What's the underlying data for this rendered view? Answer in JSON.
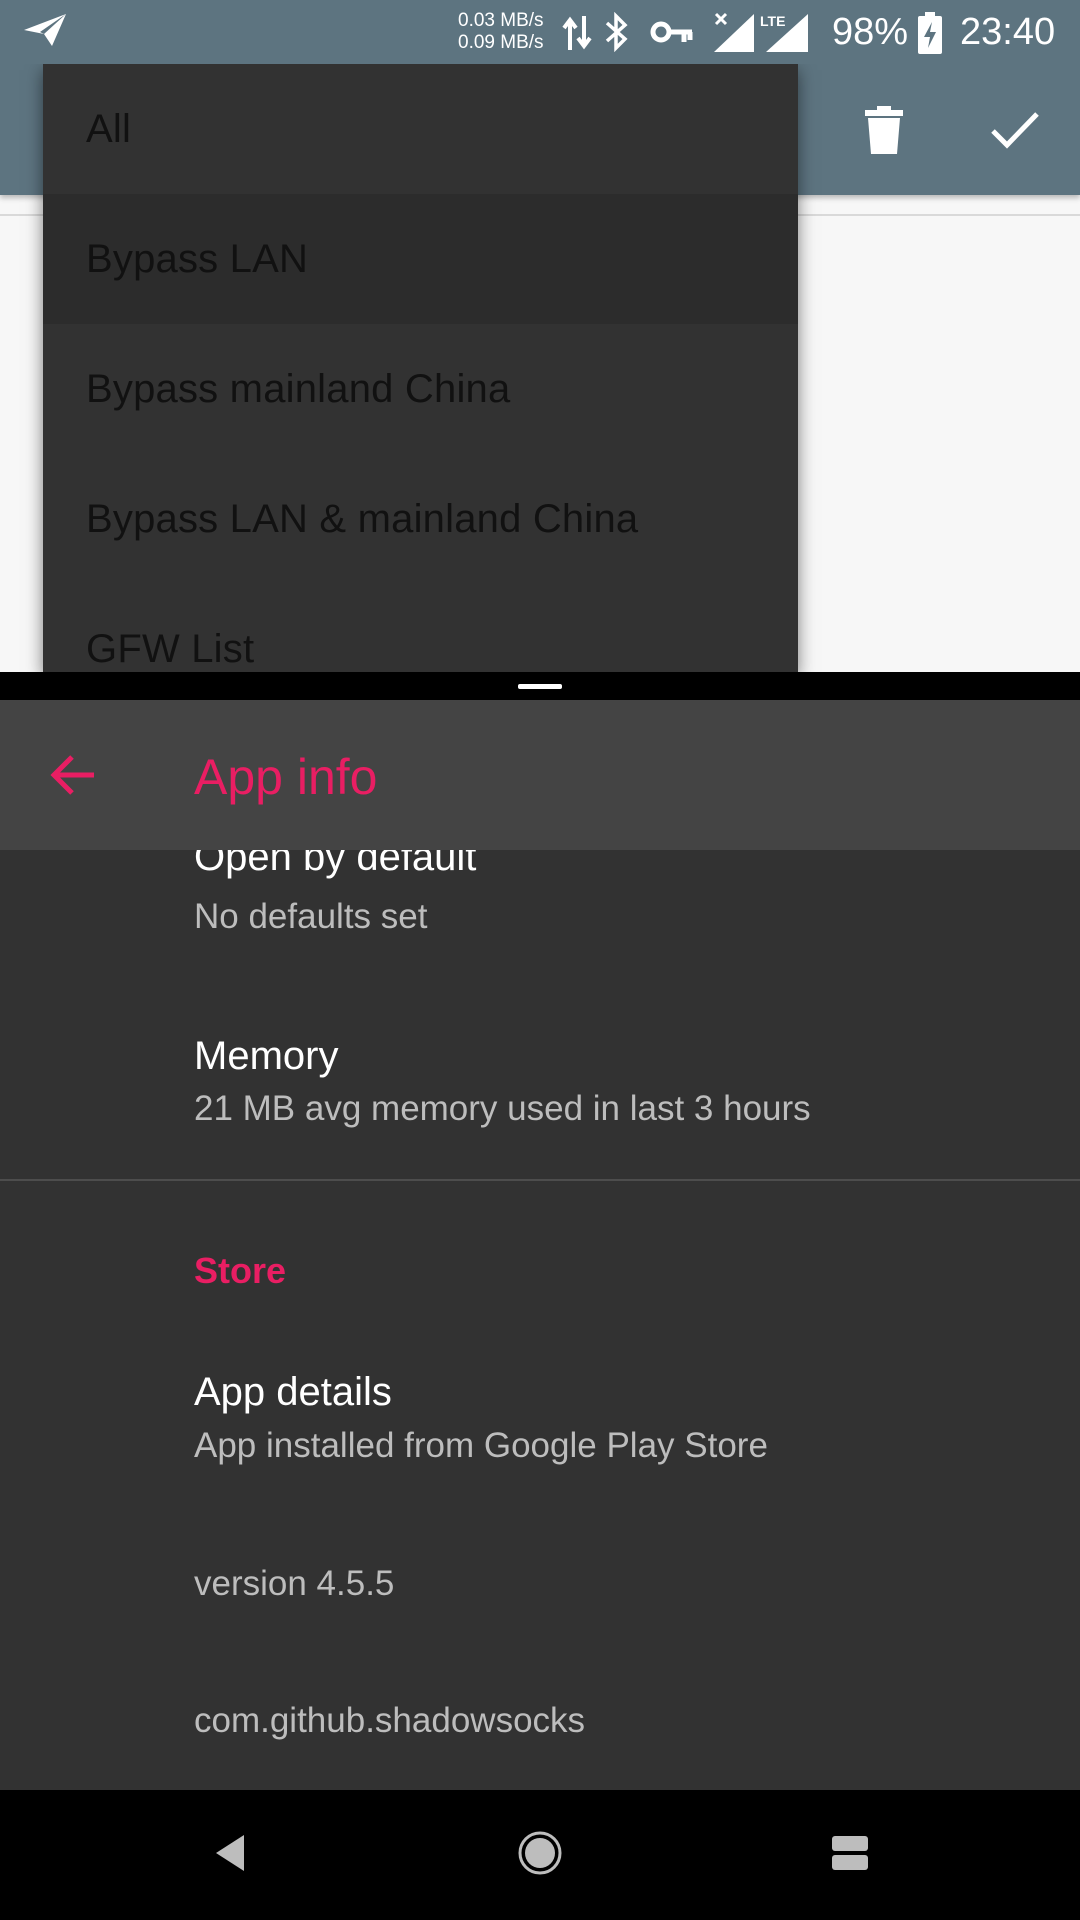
{
  "status_bar": {
    "upload_speed": "0.03 MB/s",
    "download_speed": "0.09 MB/s",
    "network_type": "LTE",
    "battery": "98%",
    "time": "23:40",
    "icons": [
      "shadowsocks-icon",
      "data-transfer-icon",
      "bluetooth-icon",
      "vpn-key-icon",
      "wifi-signal-icon",
      "cellular-signal-icon",
      "battery-charging-icon"
    ]
  },
  "top_app": {
    "toolbar": {
      "delete_icon": "trash-icon",
      "confirm_icon": "check-icon",
      "color": "#5d7480"
    },
    "dropdown": {
      "items": [
        "All",
        "Bypass LAN",
        "Bypass mainland China",
        "Bypass LAN & mainland China",
        "GFW List"
      ],
      "highlighted_index": 1
    }
  },
  "bottom_app": {
    "title": "App info",
    "accent": "#e91e63",
    "prefs": [
      {
        "title": "Open by default",
        "summary": "No defaults set"
      },
      {
        "title": "Memory",
        "summary": "21 MB avg memory used in last 3 hours"
      }
    ],
    "store": {
      "header": "Store",
      "app_details_title": "App details",
      "app_details_summary": "App installed from Google Play Store",
      "version": "version 4.5.5",
      "package": "com.github.shadowsocks"
    }
  },
  "nav_bar": {
    "back": "back-triangle-icon",
    "home": "home-circle-icon",
    "recents": "recents-icon"
  }
}
